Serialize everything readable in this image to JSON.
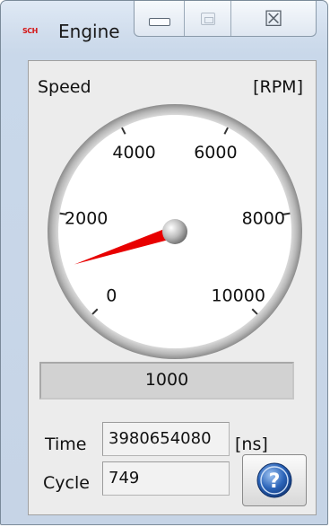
{
  "window": {
    "title": "Engine",
    "app_icon_text": "SCH"
  },
  "titlebar": {
    "minimize_icon": "minimize-icon",
    "maximize_icon": "maximize-icon",
    "close_icon": "close-icon",
    "close_glyph": "☒"
  },
  "gauge": {
    "label": "Speed",
    "unit": "[RPM]",
    "min": 0,
    "max": 10000,
    "ticks": [
      "0",
      "2000",
      "4000",
      "6000",
      "8000",
      "10000"
    ],
    "value": 1000,
    "needle_color": "#e80000",
    "value_text": "1000"
  },
  "fields": {
    "time_label": "Time",
    "time_value": "3980654080",
    "time_unit": "[ns]",
    "cycle_label": "Cycle",
    "cycle_value": "749"
  },
  "help_button": {
    "icon": "help-icon",
    "glyph": "?",
    "color": "#2a63b8"
  }
}
